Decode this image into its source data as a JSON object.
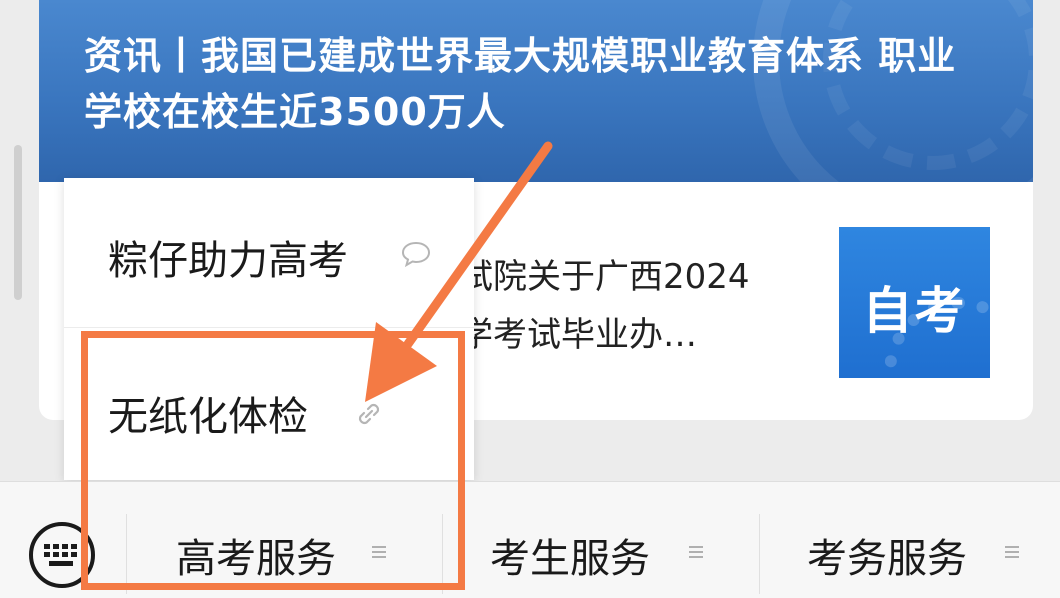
{
  "article": {
    "banner_title": "资讯丨我国已建成世界最大规模职业教育体系 职业学校在校生近3500万人",
    "item_title_line1": "试院关于广西2024",
    "item_title_line2": "学考试毕业办…",
    "thumbnail_text": "自考"
  },
  "popup_menu": {
    "items": [
      {
        "label": "粽仔助力高考",
        "icon": "speech-bubble-icon"
      },
      {
        "label": "无纸化体检",
        "icon": "link-icon"
      }
    ]
  },
  "bottom_menu": {
    "tabs": [
      {
        "label": "高考服务",
        "icon": "menu-lines-icon"
      },
      {
        "label": "考生服务",
        "icon": "menu-lines-icon"
      },
      {
        "label": "考务服务",
        "icon": "menu-lines-icon"
      }
    ],
    "keyboard_icon": "keyboard-icon"
  },
  "annotation": {
    "color": "#f47a44"
  },
  "colors": {
    "banner": "#3a76bf",
    "thumbnail": "#1f6fd0",
    "accent": "#f47a44"
  }
}
